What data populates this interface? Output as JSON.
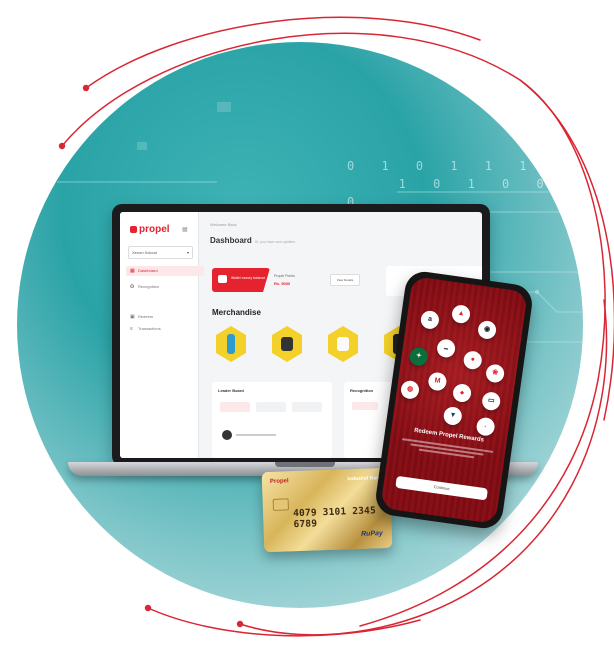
{
  "laptop": {
    "sidebar": {
      "logo": "propel",
      "company_select": "Xenon Xcloud",
      "items": [
        {
          "label": "Dashboard",
          "icon": "grid-icon",
          "active": true
        },
        {
          "label": "Recognition",
          "icon": "award-icon",
          "active": false
        },
        {
          "label": "Redeem",
          "icon": "gift-icon",
          "active": false
        },
        {
          "label": "Transactions",
          "icon": "list-icon",
          "active": false
        }
      ]
    },
    "topbar": "Welcome Back",
    "page_title": "Dashboard",
    "page_subtitle": "Hi, you have new updates",
    "wallet_card": "Wallet money balance",
    "points_label": "Propel Points",
    "points_value": "Rs. 5000",
    "history_button": "View Details",
    "merch_title": "Merchandise",
    "leaderboard_title": "Leader Board",
    "recognition_title": "Recognition"
  },
  "card": {
    "brand": "Propel",
    "bank": "IndusInd Bank",
    "number": "4079 3101 2345 6789",
    "network": "RuPay"
  },
  "phone": {
    "title": "Redeem Propel Rewards",
    "button": "Continue"
  },
  "colors": {
    "accent": "#e5232f",
    "teal": "#2aa3a7",
    "gold": "#f3d12a"
  }
}
